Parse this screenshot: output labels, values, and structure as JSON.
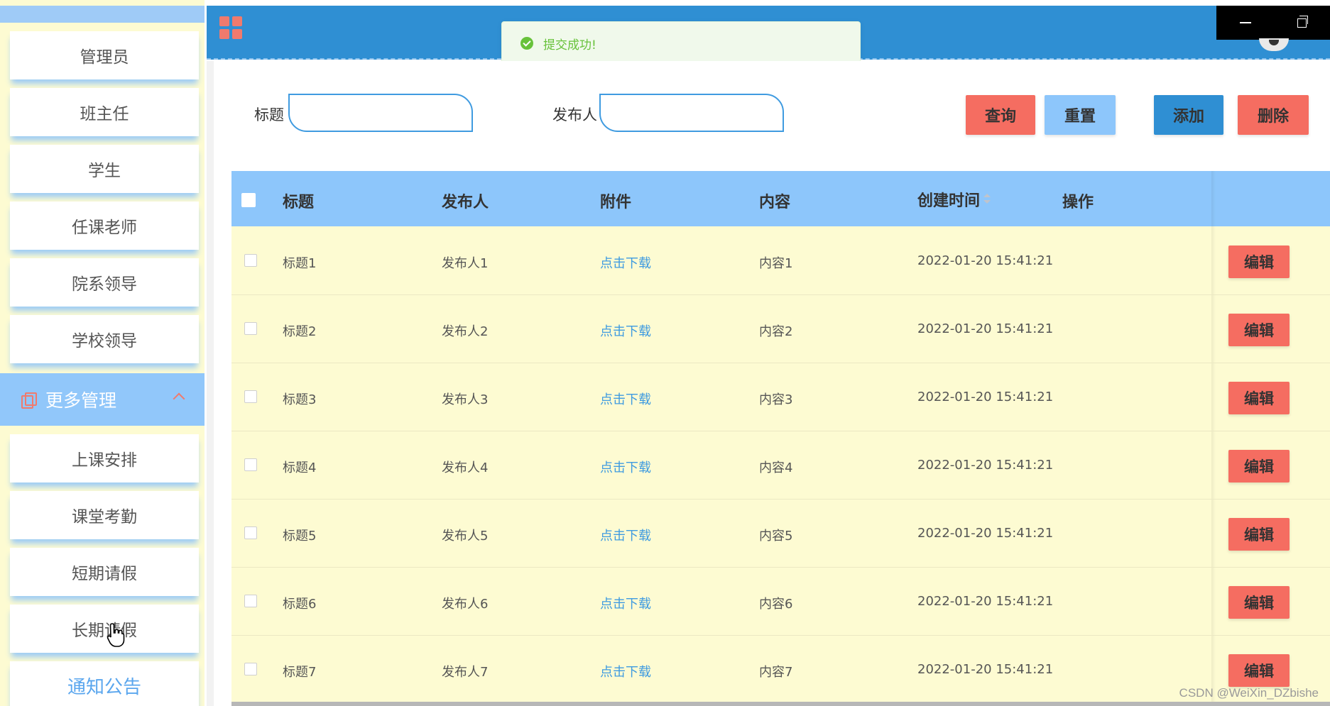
{
  "sidebar": {
    "items_top": [
      "管理员",
      "班主任",
      "学生",
      "任课老师",
      "院系领导",
      "学校领导"
    ],
    "group": {
      "label": "更多管理",
      "icon": "copy-icon",
      "arrow": "chevron-up-icon"
    },
    "items_bottom": [
      "上课安排",
      "课堂考勤",
      "短期请假",
      "长期请假",
      "通知公告"
    ]
  },
  "header": {
    "menu_icon": "grid-icon",
    "avatar": "avatar"
  },
  "toast": {
    "text": "提交成功!",
    "color": "#67c23a"
  },
  "search": {
    "title_label": "标题",
    "title_value": "",
    "publisher_label": "发布人",
    "publisher_value": ""
  },
  "toolbar": {
    "query": "查询",
    "reset": "重置",
    "add": "添加",
    "delete": "删除"
  },
  "table": {
    "columns": {
      "title": "标题",
      "publisher": "发布人",
      "attachment": "附件",
      "content": "内容",
      "created": "创建时间",
      "actions": "操作"
    },
    "rows": [
      {
        "title": "标题1",
        "publisher": "发布人1",
        "attachment": "点击下载",
        "content": "内容1",
        "created": "2022-01-20 15:41:21",
        "action": "编辑"
      },
      {
        "title": "标题2",
        "publisher": "发布人2",
        "attachment": "点击下载",
        "content": "内容2",
        "created": "2022-01-20 15:41:21",
        "action": "编辑"
      },
      {
        "title": "标题3",
        "publisher": "发布人3",
        "attachment": "点击下载",
        "content": "内容3",
        "created": "2022-01-20 15:41:21",
        "action": "编辑"
      },
      {
        "title": "标题4",
        "publisher": "发布人4",
        "attachment": "点击下载",
        "content": "内容4",
        "created": "2022-01-20 15:41:21",
        "action": "编辑"
      },
      {
        "title": "标题5",
        "publisher": "发布人5",
        "attachment": "点击下载",
        "content": "内容5",
        "created": "2022-01-20 15:41:21",
        "action": "编辑"
      },
      {
        "title": "标题6",
        "publisher": "发布人6",
        "attachment": "点击下载",
        "content": "内容6",
        "created": "2022-01-20 15:41:21",
        "action": "编辑"
      },
      {
        "title": "标题7",
        "publisher": "发布人7",
        "attachment": "点击下载",
        "content": "内容7",
        "created": "2022-01-20 15:41:21",
        "action": "编辑"
      }
    ]
  },
  "watermark": "CSDN @WeiXin_DZbishe",
  "colors": {
    "sidebar_bg": "#fdfbd2",
    "header_bg": "#2f8fd3",
    "table_header_bg": "#8dc6fb",
    "danger": "#f56d61",
    "link": "#3f9be0"
  }
}
